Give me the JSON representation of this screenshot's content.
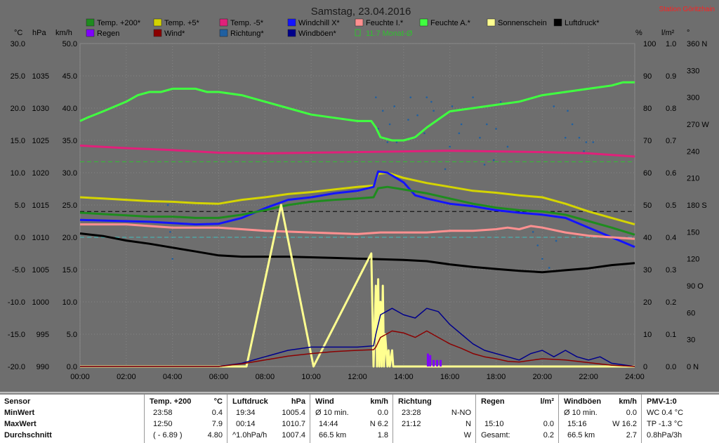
{
  "title": "Samstag, 23.04.2016",
  "station": "Station Göritzhain",
  "axis_units": {
    "temp": "°C",
    "pressure": "hPa",
    "wind": "km/h",
    "humidity": "%",
    "rain": "l/m²",
    "direction": "°"
  },
  "legend": [
    {
      "label": "Temp. +200*",
      "color": "#1e8c1e"
    },
    {
      "label": "Temp. +5*",
      "color": "#d4d400"
    },
    {
      "label": "Temp. -5*",
      "color": "#e0207a"
    },
    {
      "label": "Windchill X*",
      "color": "#1414ff"
    },
    {
      "label": "Feuchte I.*",
      "color": "#ff9090"
    },
    {
      "label": "Feuchte A.*",
      "color": "#40ff40"
    },
    {
      "label": "Sonnenschein",
      "color": "#ffff90"
    },
    {
      "label": "Luftdruck*",
      "color": "#000000"
    },
    {
      "label": "Regen",
      "color": "#8000ff"
    },
    {
      "label": "Wind*",
      "color": "#8b0000"
    },
    {
      "label": "Richtung*",
      "color": "#2060a0"
    },
    {
      "label": "Windböen*",
      "color": "#00008b"
    },
    {
      "label": "11.7 Monat-Ø",
      "color": "#30c030"
    }
  ],
  "chart_data": {
    "type": "line",
    "title": "Samstag, 23.04.2016",
    "xlim": [
      0,
      24
    ],
    "x_ticks": [
      "00:00",
      "02:00",
      "04:00",
      "06:00",
      "08:00",
      "10:00",
      "12:00",
      "14:00",
      "16:00",
      "18:00",
      "20:00",
      "22:00",
      "24:00"
    ],
    "y_axes": {
      "temp": {
        "unit": "°C",
        "range": [
          -20,
          30
        ],
        "ticks": [
          "30.0",
          "25.0",
          "20.0",
          "15.0",
          "10.0",
          "5.0",
          "0.0",
          "-5.0",
          "-10.0",
          "-15.0",
          "-20.0"
        ]
      },
      "pressure": {
        "unit": "hPa",
        "range": [
          990,
          1040
        ],
        "ticks": [
          "1035",
          "1030",
          "1025",
          "1020",
          "1015",
          "1010",
          "1005",
          "1000",
          "995",
          "990"
        ]
      },
      "wind": {
        "unit": "km/h",
        "range": [
          0,
          50
        ],
        "ticks": [
          "50.0",
          "45.0",
          "40.0",
          "35.0",
          "30.0",
          "25.0",
          "20.0",
          "15.0",
          "10.0",
          "5.0",
          "0.0"
        ]
      },
      "humidity": {
        "unit": "%",
        "range": [
          0,
          100
        ],
        "ticks": [
          "100",
          "90",
          "80",
          "70",
          "60",
          "50",
          "40",
          "30",
          "20",
          "10",
          "0"
        ]
      },
      "rain": {
        "unit": "l/m²",
        "range": [
          0,
          1
        ],
        "ticks": [
          "1.0",
          "0.9",
          "0.8",
          "0.7",
          "0.6",
          "0.5",
          "0.4",
          "0.3",
          "0.2",
          "0.1",
          "0.0"
        ]
      },
      "direction": {
        "unit": "°",
        "range": [
          0,
          360
        ],
        "ticks": [
          "360 N",
          "330",
          "300",
          "270 W",
          "240",
          "210",
          "180 S",
          "150",
          "120",
          "90 O",
          "60",
          "30",
          "0 N"
        ]
      }
    },
    "reference_lines": [
      {
        "name": "11.7 Monat-Ø",
        "axis": "temp",
        "value": 11.7,
        "color": "#30c030"
      },
      {
        "name": "",
        "axis": "temp",
        "value": 4.0,
        "color": "#000000"
      },
      {
        "name": "",
        "axis": "temp",
        "value": 0.0,
        "color": "#40c0c0"
      }
    ],
    "series": [
      {
        "name": "Feuchte A.*",
        "axis": "humidity",
        "color": "#40ff40",
        "x": [
          0,
          0.3,
          1,
          2,
          2.5,
          3,
          3.5,
          4,
          5,
          5.5,
          6,
          7,
          8,
          9,
          10,
          11,
          12,
          12.6,
          12.8,
          13,
          13.5,
          14,
          14.5,
          15,
          16,
          17,
          18,
          19,
          20,
          21,
          22,
          23,
          23.5,
          24
        ],
        "y": [
          76,
          77,
          79,
          82,
          84,
          85,
          85,
          86,
          86,
          85,
          85,
          84,
          82,
          80,
          78,
          77,
          76,
          76,
          74,
          71,
          70,
          70,
          71,
          74,
          79,
          80,
          81,
          82,
          84,
          85,
          86,
          87,
          88,
          88
        ]
      },
      {
        "name": "Temp. -5*",
        "axis": "temp",
        "color": "#e0207a",
        "x": [
          0,
          2,
          4,
          6,
          8,
          10,
          12,
          14,
          16,
          18,
          20,
          22,
          24
        ],
        "y": [
          14.2,
          13.8,
          13.5,
          13.1,
          13.0,
          13.1,
          13.2,
          13.3,
          13.4,
          13.3,
          13.2,
          13.0,
          12.5
        ]
      },
      {
        "name": "Temp. +5*",
        "axis": "temp",
        "color": "#d4d400",
        "x": [
          0,
          1,
          2,
          3,
          4,
          5,
          6,
          7,
          8,
          9,
          10,
          11,
          12,
          12.7,
          12.9,
          13.3,
          14,
          15,
          16,
          17,
          18,
          19,
          20,
          21,
          22,
          23,
          24
        ],
        "y": [
          6.2,
          6.0,
          5.8,
          5.6,
          5.5,
          5.3,
          5.2,
          5.8,
          6.2,
          6.7,
          7.0,
          7.4,
          7.8,
          8.0,
          9.8,
          10.0,
          9.2,
          8.4,
          7.8,
          7.2,
          6.9,
          6.5,
          6.2,
          5.2,
          4.0,
          3.0,
          2.0
        ]
      },
      {
        "name": "Windchill X*",
        "axis": "temp",
        "color": "#1414ff",
        "x": [
          0,
          1,
          2,
          3,
          4,
          5,
          6,
          7,
          8,
          9,
          10,
          11,
          12,
          12.7,
          12.9,
          13.3,
          14,
          14.5,
          15,
          16,
          17,
          18,
          19,
          20,
          21,
          22,
          23,
          24
        ],
        "y": [
          2.7,
          2.6,
          2.5,
          2.4,
          2.2,
          2.0,
          2.1,
          3.0,
          4.5,
          5.8,
          6.2,
          6.8,
          7.2,
          7.8,
          10.2,
          10.0,
          8.5,
          6.5,
          6.0,
          5.2,
          4.8,
          4.2,
          3.8,
          3.5,
          3.0,
          1.5,
          0.0,
          -1.5
        ]
      },
      {
        "name": "Temp. +200*",
        "axis": "temp",
        "color": "#1e8c1e",
        "x": [
          0,
          1,
          2,
          3,
          4,
          5,
          6,
          7,
          8,
          9,
          10,
          11,
          12,
          12.7,
          12.9,
          13.3,
          14,
          15,
          16,
          17,
          18,
          19,
          20,
          21,
          22,
          23,
          24
        ],
        "y": [
          3.8,
          3.6,
          3.4,
          3.2,
          3.2,
          3.0,
          3.0,
          3.5,
          4.2,
          5.0,
          5.5,
          5.8,
          6.0,
          6.2,
          7.6,
          7.8,
          7.4,
          6.8,
          6.0,
          5.2,
          4.6,
          4.2,
          4.0,
          3.5,
          2.5,
          1.5,
          0.4
        ]
      },
      {
        "name": "Feuchte I.*",
        "axis": "humidity",
        "color": "#ff9090",
        "x": [
          0,
          2,
          4,
          6,
          8,
          10,
          12,
          13,
          14,
          15,
          16,
          17,
          18,
          18.5,
          19,
          19.5,
          20,
          21,
          22,
          23,
          24
        ],
        "y": [
          44,
          44,
          43,
          43,
          42,
          41.5,
          41,
          41.5,
          41.5,
          41.5,
          42,
          42,
          42.5,
          43,
          42.5,
          43.5,
          43,
          41.5,
          40.5,
          40,
          39.5
        ]
      },
      {
        "name": "Luftdruck*",
        "axis": "pressure",
        "color": "#000000",
        "x": [
          0,
          1,
          2,
          3,
          4,
          5,
          6,
          7,
          8,
          9,
          10,
          11,
          12,
          13,
          14,
          15,
          16,
          17,
          18,
          19,
          20,
          21,
          22,
          23,
          24
        ],
        "y": [
          1010.6,
          1010.2,
          1009.5,
          1009.0,
          1008.4,
          1007.8,
          1007.2,
          1007.0,
          1007.0,
          1007.0,
          1006.9,
          1006.8,
          1006.7,
          1006.6,
          1006.5,
          1006.3,
          1005.8,
          1005.4,
          1005.1,
          1004.8,
          1004.6,
          1004.9,
          1005.2,
          1005.7,
          1006.0
        ]
      },
      {
        "name": "Sonnenschein",
        "axis": "humidity",
        "color": "#ffff90",
        "x": [
          0,
          7.2,
          8.7,
          10.1,
          12.6,
          12.7,
          12.8,
          12.85,
          12.9,
          12.95,
          13.0,
          13.05,
          13.1,
          13.15,
          13.2,
          13.3,
          13.35,
          13.4,
          13.5,
          13.55,
          24
        ],
        "y": [
          0,
          0,
          50,
          0,
          35,
          0,
          25,
          0,
          27,
          0,
          20,
          0,
          25,
          0,
          10,
          0,
          5,
          0,
          5,
          0,
          0
        ]
      },
      {
        "name": "Windböen*",
        "axis": "wind",
        "color": "#00008b",
        "x": [
          0,
          3,
          6,
          7,
          8,
          9,
          10,
          11,
          12,
          12.7,
          12.8,
          13,
          13.5,
          14,
          14.5,
          15,
          15.5,
          16,
          16.5,
          17,
          17.5,
          18,
          18.5,
          19,
          19.5,
          20,
          20.5,
          21,
          21.5,
          22,
          22.5,
          23,
          24
        ],
        "y": [
          0,
          0,
          0,
          0.5,
          1.5,
          2.5,
          3.0,
          3.0,
          3.0,
          3.2,
          5.0,
          8.0,
          9.0,
          8.0,
          7.5,
          9.0,
          8.5,
          6.5,
          5.0,
          3.5,
          2.5,
          2.0,
          1.5,
          1.0,
          2.0,
          2.5,
          1.5,
          2.5,
          1.5,
          1.0,
          1.5,
          0.5,
          0
        ]
      },
      {
        "name": "Wind*",
        "axis": "wind",
        "color": "#8b0000",
        "x": [
          0,
          3,
          6,
          7,
          8,
          9,
          10,
          11,
          12,
          12.7,
          12.8,
          13,
          13.5,
          14,
          14.5,
          15,
          15.5,
          16,
          16.5,
          17,
          17.5,
          18,
          18.5,
          19,
          20,
          21,
          22,
          23,
          24
        ],
        "y": [
          0,
          0,
          0,
          0.4,
          1.0,
          1.6,
          2.0,
          2.3,
          2.5,
          2.6,
          3.0,
          4.5,
          5.5,
          5.2,
          4.5,
          5.5,
          4.5,
          3.5,
          2.8,
          2.0,
          1.5,
          1.2,
          0.8,
          0.7,
          1.2,
          1.0,
          0.6,
          0.2,
          0
        ]
      },
      {
        "name": "Regen",
        "axis": "rain",
        "color": "#8000ff",
        "type": "bar",
        "x": [
          15.05,
          15.15,
          15.3,
          15.45,
          15.6
        ],
        "y": [
          0.04,
          0.035,
          0.02,
          0.02,
          0.02
        ]
      }
    ],
    "direction_points": {
      "name": "Richtung*",
      "axis": "direction",
      "color": "#2060a0",
      "x": [
        3.8,
        3.9,
        4.0,
        12.8,
        13.1,
        13.4,
        13.7,
        14.0,
        14.3,
        14.6,
        14.9,
        15.2,
        15.5,
        15.8,
        16.1,
        16.4,
        16.7,
        17.0,
        17.3,
        17.6,
        17.9,
        18.2,
        18.5,
        19.6,
        19.8,
        20.0,
        20.3,
        20.6,
        21.1,
        21.3,
        21.6,
        21.9,
        22.2,
        12.9,
        13.3,
        13.6,
        14.2,
        14.5,
        15.0,
        15.3,
        16.0,
        16.5,
        17.5,
        18.0,
        20.5,
        21.0,
        21.8
      ],
      "y": [
        180,
        150,
        120,
        300,
        285,
        270,
        250,
        240,
        300,
        280,
        260,
        295,
        275,
        220,
        290,
        260,
        240,
        300,
        255,
        270,
        230,
        295,
        245,
        150,
        135,
        120,
        110,
        140,
        285,
        270,
        255,
        250,
        250,
        265,
        250,
        290,
        275,
        255,
        300,
        285,
        245,
        270,
        225,
        265,
        290,
        255,
        240
      ]
    },
    "annotations": [
      "Samstag, 23.04.2016",
      "Station Göritzhain"
    ]
  },
  "stats": {
    "labels": {
      "sensor": "Sensor",
      "min": "MinWert",
      "max": "MaxWert",
      "avg": "Durchschnitt"
    },
    "temp": {
      "header": "Temp. +200",
      "unit": "°C",
      "min_time": "23:58",
      "min_val": "0.4",
      "max_time": "12:50",
      "max_val": "7.9",
      "avg_time": "( - 6.89 )",
      "avg_val": "4.80"
    },
    "pressure": {
      "header": "Luftdruck",
      "unit": "hPa",
      "min_time": "19:34",
      "min_val": "1005.4",
      "max_time": "00:14",
      "max_val": "1010.7",
      "avg_time": "^1.0hPa/h",
      "avg_val": "1007.4"
    },
    "wind": {
      "header": "Wind",
      "unit": "km/h",
      "min_time": "Ø 10 min.",
      "min_val": "0.0",
      "max_time": "14:44",
      "max_val": "N 6.2",
      "avg_time": "66.5 km",
      "avg_val": "1.8"
    },
    "direction": {
      "header": "Richtung",
      "min_time": "23:28",
      "min_val": "N-NO",
      "max_time": "21:12",
      "max_val": "N",
      "avg_val": "W"
    },
    "rain": {
      "header": "Regen",
      "unit": "l/m²",
      "max_time": "15:10",
      "max_val": "0.0",
      "avg_time": "Gesamt:",
      "avg_val": "0.2"
    },
    "gust": {
      "header": "Windböen",
      "unit": "km/h",
      "min_time": "Ø 10 min.",
      "min_val": "0.0",
      "max_time": "15:16",
      "max_val": "W 16.2",
      "avg_time": "66.5 km",
      "avg_val": "2.7"
    },
    "pmv": {
      "header": "PMV-1:0",
      "min_val": "WC 0.4 °C",
      "max_val": "TP -1.3 °C",
      "avg_val": "0.8hPa/3h"
    }
  }
}
